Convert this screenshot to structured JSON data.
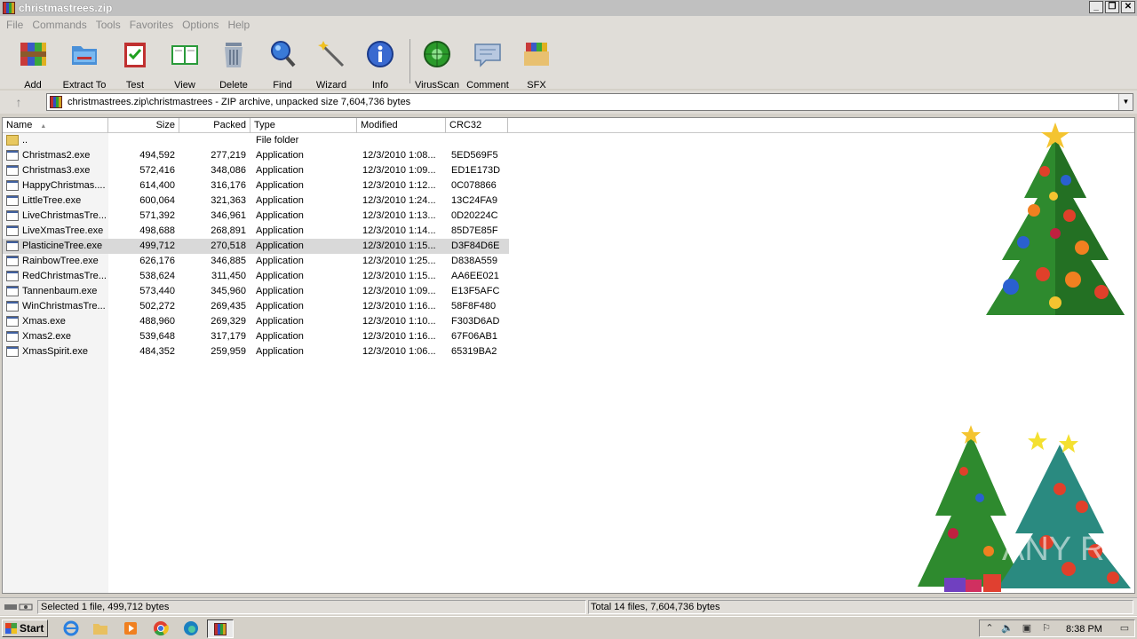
{
  "window": {
    "title": "christmastrees.zip",
    "controls": [
      "_",
      "❐",
      "✕"
    ]
  },
  "menu": [
    "File",
    "Commands",
    "Tools",
    "Favorites",
    "Options",
    "Help"
  ],
  "toolbar": [
    {
      "label": "Add",
      "icon": "add-archive-icon"
    },
    {
      "label": "Extract To",
      "icon": "extract-folder-icon"
    },
    {
      "label": "Test",
      "icon": "test-clipboard-icon"
    },
    {
      "label": "View",
      "icon": "view-book-icon"
    },
    {
      "label": "Delete",
      "icon": "trash-bin-icon"
    },
    {
      "label": "Find",
      "icon": "magnifier-icon"
    },
    {
      "label": "Wizard",
      "icon": "magic-wand-icon"
    },
    {
      "label": "Info",
      "icon": "info-icon"
    },
    {
      "label": "VirusScan",
      "icon": "virus-scan-icon"
    },
    {
      "label": "Comment",
      "icon": "comment-icon"
    },
    {
      "label": "SFX",
      "icon": "sfx-box-icon"
    }
  ],
  "address": {
    "path": "christmastrees.zip\\christmastrees - ZIP archive, unpacked size 7,604,736 bytes",
    "up_arrow": "↑",
    "dropdown": "▼"
  },
  "columns": {
    "name": "Name",
    "size": "Size",
    "packed": "Packed",
    "type": "Type",
    "modified": "Modified",
    "crc": "CRC32",
    "sort_arrow": "▲"
  },
  "parent_row": {
    "name": "..",
    "type": "File folder"
  },
  "files": [
    {
      "name": "Christmas2.exe",
      "size": "494,592",
      "packed": "277,219",
      "type": "Application",
      "modified": "12/3/2010 1:08...",
      "crc": "5ED569F5"
    },
    {
      "name": "Christmas3.exe",
      "size": "572,416",
      "packed": "348,086",
      "type": "Application",
      "modified": "12/3/2010 1:09...",
      "crc": "ED1E173D"
    },
    {
      "name": "HappyChristmas....",
      "size": "614,400",
      "packed": "316,176",
      "type": "Application",
      "modified": "12/3/2010 1:12...",
      "crc": "0C078866"
    },
    {
      "name": "LittleTree.exe",
      "size": "600,064",
      "packed": "321,363",
      "type": "Application",
      "modified": "12/3/2010 1:24...",
      "crc": "13C24FA9"
    },
    {
      "name": "LiveChristmasTre...",
      "size": "571,392",
      "packed": "346,961",
      "type": "Application",
      "modified": "12/3/2010 1:13...",
      "crc": "0D20224C"
    },
    {
      "name": "LiveXmasTree.exe",
      "size": "498,688",
      "packed": "268,891",
      "type": "Application",
      "modified": "12/3/2010 1:14...",
      "crc": "85D7E85F"
    },
    {
      "name": "PlasticineTree.exe",
      "size": "499,712",
      "packed": "270,518",
      "type": "Application",
      "modified": "12/3/2010 1:15...",
      "crc": "D3F84D6E",
      "selected": true
    },
    {
      "name": "RainbowTree.exe",
      "size": "626,176",
      "packed": "346,885",
      "type": "Application",
      "modified": "12/3/2010 1:25...",
      "crc": "D838A559"
    },
    {
      "name": "RedChristmasTre...",
      "size": "538,624",
      "packed": "311,450",
      "type": "Application",
      "modified": "12/3/2010 1:15...",
      "crc": "AA6EE021"
    },
    {
      "name": "Tannenbaum.exe",
      "size": "573,440",
      "packed": "345,960",
      "type": "Application",
      "modified": "12/3/2010 1:09...",
      "crc": "E13F5AFC"
    },
    {
      "name": "WinChristmasTre...",
      "size": "502,272",
      "packed": "269,435",
      "type": "Application",
      "modified": "12/3/2010 1:16...",
      "crc": "58F8F480"
    },
    {
      "name": "Xmas.exe",
      "size": "488,960",
      "packed": "269,329",
      "type": "Application",
      "modified": "12/3/2010 1:10...",
      "crc": "F303D6AD"
    },
    {
      "name": "Xmas2.exe",
      "size": "539,648",
      "packed": "317,179",
      "type": "Application",
      "modified": "12/3/2010 1:16...",
      "crc": "67F06AB1"
    },
    {
      "name": "XmasSpirit.exe",
      "size": "484,352",
      "packed": "259,959",
      "type": "Application",
      "modified": "12/3/2010 1:06...",
      "crc": "65319BA2"
    }
  ],
  "status": {
    "left": "Selected 1 file, 499,712 bytes",
    "right": "Total 14 files, 7,604,736 bytes"
  },
  "taskbar": {
    "start_label": "Start",
    "quick_launch": [
      "ie-icon",
      "explorer-folder-icon",
      "media-player-icon",
      "chrome-icon",
      "edge-icon"
    ],
    "active_task_icon": "winrar-icon",
    "tray_icons": [
      "show-hidden-arrow-icon",
      "volume-icon",
      "network-icon",
      "flag-icon",
      "monitor-icon"
    ],
    "clock": "8:38 PM"
  },
  "watermark": "ANY RUN"
}
